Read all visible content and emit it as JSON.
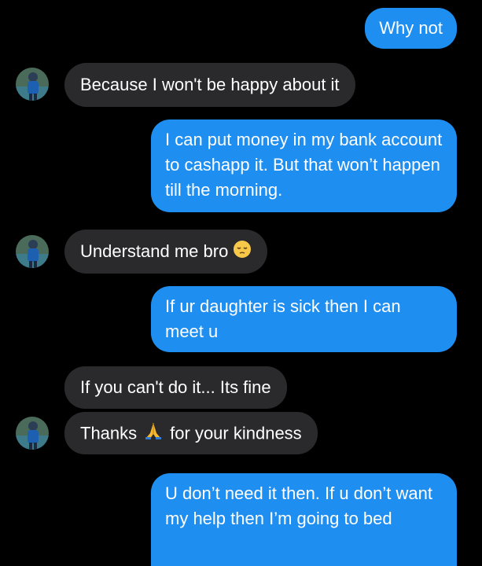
{
  "conversation": {
    "messages": [
      {
        "sender": "self",
        "text": "Why not"
      },
      {
        "sender": "other",
        "text": "Because I won't be happy about it"
      },
      {
        "sender": "self",
        "text": "I can put money in my bank account to cashapp it. But that won’t happen till the morning."
      },
      {
        "sender": "other",
        "text": "Understand me bro",
        "emoji": "pensive-face-emoji"
      },
      {
        "sender": "self",
        "text": "If ur daughter is sick then I can meet u"
      },
      {
        "sender": "other",
        "text": "If you can't do it... Its fine"
      },
      {
        "sender": "other",
        "text_before": "Thanks",
        "emoji": "folded-hands-emoji",
        "text_after": "for your kindness"
      },
      {
        "sender": "self",
        "text": "U don’t need it then. If u don’t want my help then I’m going to bed"
      }
    ]
  },
  "colors": {
    "background": "#000000",
    "sent_bubble": "#1f8ef1",
    "received_bubble": "#2a2a2c",
    "text": "#ffffff"
  }
}
